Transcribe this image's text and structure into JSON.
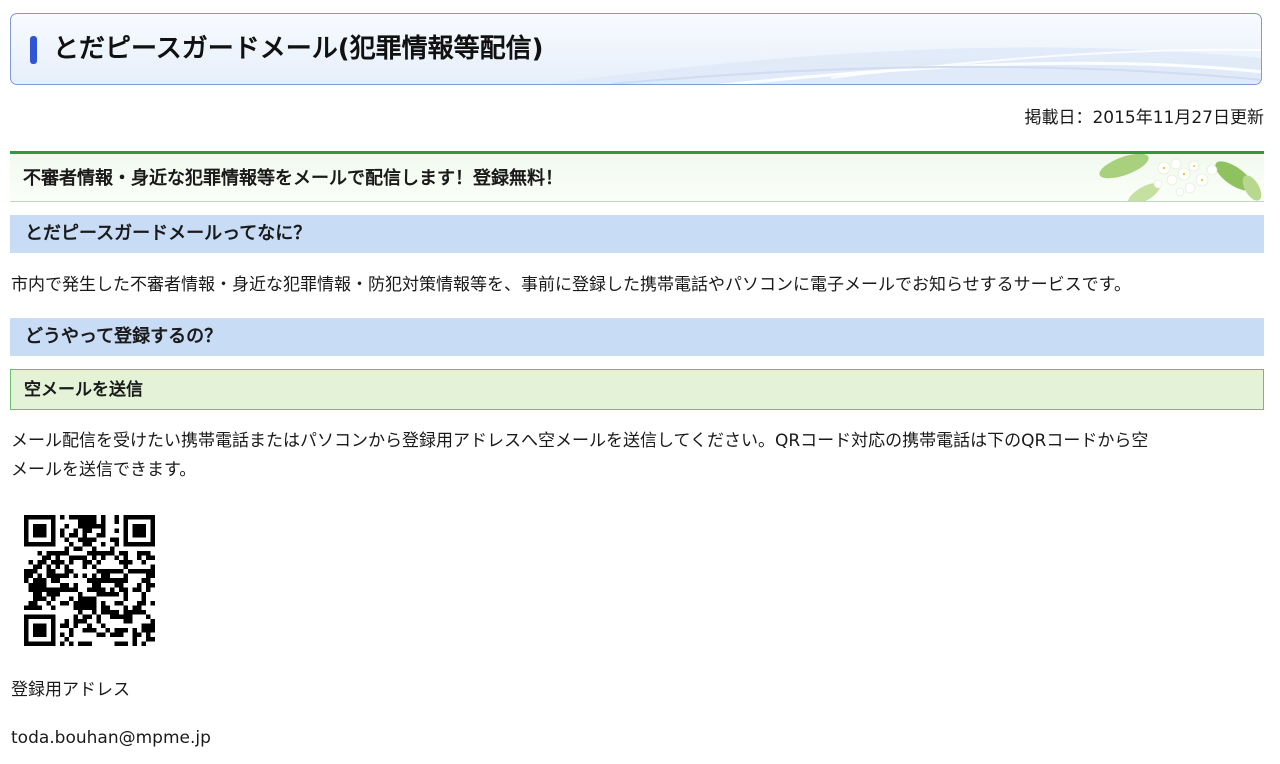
{
  "page": {
    "title": "とだピースガードメール(犯罪情報等配信)",
    "updated": "掲載日：2015年11月27日更新",
    "banner": "不審者情報・身近な犯罪情報等をメールで配信します！登録無料！"
  },
  "section1": {
    "heading": "とだピースガードメールってなに？",
    "body": "市内で発生した不審者情報・身近な犯罪情報・防犯対策情報等を、事前に登録した携帯電話やパソコンに電子メールでお知らせするサービスです。"
  },
  "section2": {
    "heading": "どうやって登録するの？",
    "subheading": "空メールを送信",
    "body_line1": "メール配信を受けたい携帯電話またはパソコンから登録用アドレスへ空メールを送信してください。QRコード対応の携帯電話は下のQRコードから空",
    "body_line2": "メールを送信できます。",
    "address_label": "登録用アドレス",
    "address": "toda.bouhan@mpme.jp"
  },
  "colors": {
    "accent_blue": "#2f55d4",
    "heading_blue": "#c8dcf6",
    "heading_green_fill": "#e4f3d8",
    "heading_green_border": "#6bbf70",
    "banner_green": "#2e9a3c"
  },
  "icons": {
    "title_marker": "vertical-bar",
    "qr_code": "qr-code-image",
    "banner_decoration": "white-flowers-image"
  }
}
